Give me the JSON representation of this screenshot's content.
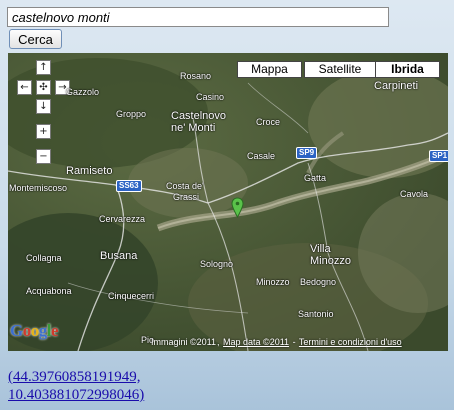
{
  "search": {
    "value": "castelnovo monti",
    "button_label": "Cerca"
  },
  "map": {
    "map_types": [
      "Mappa",
      "Satellite",
      "Ibrida"
    ],
    "active_map_type": "Ibrida",
    "nav_glyphs": {
      "up": "↑",
      "left": "←",
      "center": "✣",
      "right": "→",
      "down": "↓",
      "zoom_in": "+",
      "zoom_out": "−"
    },
    "places": {
      "rosano": "Rosano",
      "carpineti": "Carpineti",
      "casino": "Casino",
      "groppo": "Groppo",
      "castelnovo_line1": "Castelnovo",
      "castelnovo_line2": "ne' Monti",
      "croce": "Croce",
      "gazzolo": "Gazzolo",
      "casale": "Casale",
      "ramiseto": "Ramiseto",
      "gatta": "Gatta",
      "costa_line1": "Costa de'",
      "costa_line2": "Grassi",
      "montemiscoso": "Montemiscoso",
      "cavola": "Cavola",
      "cervarezza": "Cervarezza",
      "villa_line1": "Villa",
      "villa_line2": "Minozzo",
      "busana": "Busana",
      "sologno": "Sologno",
      "collagna": "Collagna",
      "minozzo": "Minozzo",
      "bedogno": "Bedogno",
      "acquabona": "Acquabona",
      "cinquecerri": "Cinquecerri",
      "santonio": "Santonio",
      "piolo": "Pio"
    },
    "road_shields": {
      "ss63": "SS63",
      "sp9a": "SP9",
      "sp9b": "SP1"
    },
    "copyright": {
      "imagery": "Immagini ©2011",
      "mapdata": "Map data ©2011",
      "terms": "Termini e condizioni d'uso"
    },
    "logo": {
      "letters": [
        "G",
        "o",
        "o",
        "g",
        "l",
        "e"
      ],
      "colors": [
        "#3d6fd1",
        "#d0392b",
        "#e7b416",
        "#3d6fd1",
        "#3a9b3a",
        "#d0392b"
      ]
    },
    "marker_color": "#5ac24a"
  },
  "coords": {
    "line1": "(44.39760858191949,",
    "line2": "10.403881072998046)"
  }
}
